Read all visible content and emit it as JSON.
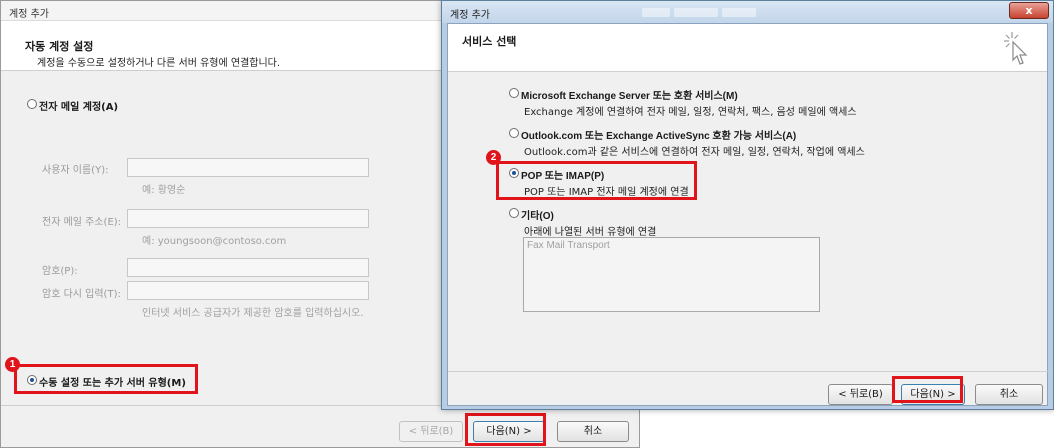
{
  "back_window": {
    "title": "계정 추가",
    "header": {
      "title": "자동 계정 설정",
      "subtitle": "계정을 수동으로 설정하거나 다른 서버 유형에 연결합니다."
    },
    "email_account_option": "전자 메일 계정(A)",
    "fields": {
      "name_label": "사용자 이름(Y):",
      "name_hint": "예: 황영순",
      "email_label": "전자 메일 주소(E):",
      "email_hint": "예: youngsoon@contoso.com",
      "password_label": "암호(P):",
      "retype_label": "암호 다시 입력(T):",
      "password_hint": "인터넷 서비스 공급자가 제공한 암호를 입력하십시오."
    },
    "manual_option": "수동 설정 또는 추가 서버 유형(M)",
    "buttons": {
      "back": "< 뒤로(B)",
      "next": "다음(N) >",
      "cancel": "취소"
    }
  },
  "front_window": {
    "title": "계정 추가",
    "close_glyph": "x",
    "header": {
      "title": "서비스 선택"
    },
    "options": [
      {
        "label": "Microsoft Exchange Server 또는 호환 서비스(M)",
        "description": "Exchange 계정에 연결하여 전자 메일, 일정, 연락처, 팩스, 음성 메일에 액세스"
      },
      {
        "label": "Outlook.com 또는 Exchange ActiveSync 호환 가능 서비스(A)",
        "description": "Outlook.com과 같은 서비스에 연결하여 전자 메일, 일정, 연락처, 작업에 액세스"
      },
      {
        "label": "POP 또는 IMAP(P)",
        "description": "POP 또는 IMAP 전자 메일 계정에 연결"
      },
      {
        "label": "기타(O)",
        "description": "아래에 나열된 서버 유형에 연결"
      }
    ],
    "selected_option": 2,
    "other_list": [
      "Fax Mail Transport"
    ],
    "buttons": {
      "back": "< 뒤로(B)",
      "next": "다음(N) >",
      "cancel": "취소"
    }
  },
  "annotations": {
    "step1": "1",
    "step2": "2"
  },
  "colors": {
    "highlight": "#e0141a",
    "radio_dot": "#1d4f9a",
    "window_frame": "#b8cde3"
  }
}
